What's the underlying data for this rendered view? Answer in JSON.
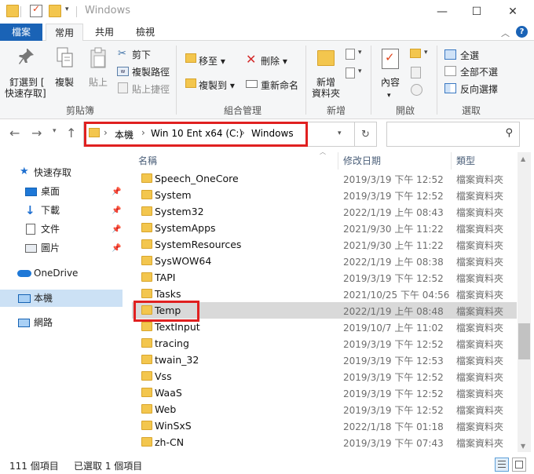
{
  "window": {
    "title": "Windows",
    "controls": {
      "minimize": "—",
      "maximize": "☐",
      "close": "✕"
    }
  },
  "ribbon_tabs": [
    {
      "label": "檔案"
    },
    {
      "label": "常用"
    },
    {
      "label": "共用"
    },
    {
      "label": "檢視"
    }
  ],
  "ribbon": {
    "clipboard": {
      "group_label": "剪貼簿",
      "pin_line1": "釘選到 [",
      "pin_line2": "快速存取]",
      "copy": "複製",
      "paste": "貼上",
      "cut": "剪下",
      "copy_path": "複製路徑",
      "paste_shortcut": "貼上捷徑"
    },
    "organize": {
      "group_label": "組合管理",
      "move_to": "移至",
      "copy_to": "複製到",
      "delete": "刪除",
      "rename": "重新命名"
    },
    "new": {
      "group_label": "新增",
      "new_folder_line1": "新增",
      "new_folder_line2": "資料夾"
    },
    "open": {
      "group_label": "開啟",
      "properties": "內容"
    },
    "select": {
      "group_label": "選取",
      "select_all": "全選",
      "select_none": "全部不選",
      "invert": "反向選擇"
    }
  },
  "address": {
    "crumbs": [
      "本機",
      "Win 10 Ent x64 (C:)",
      "Windows"
    ]
  },
  "nav": {
    "quick_access": "快速存取",
    "desktop": "桌面",
    "downloads": "下載",
    "documents": "文件",
    "pictures": "圖片",
    "onedrive": "OneDrive",
    "this_pc": "本機",
    "network": "網路"
  },
  "columns": {
    "name": "名稱",
    "date": "修改日期",
    "type": "類型"
  },
  "files": [
    {
      "name": "Speech_OneCore",
      "date": "2019/3/19 下午 12:52",
      "type": "檔案資料夾"
    },
    {
      "name": "System",
      "date": "2019/3/19 下午 12:52",
      "type": "檔案資料夾"
    },
    {
      "name": "System32",
      "date": "2022/1/19 上午 08:43",
      "type": "檔案資料夾"
    },
    {
      "name": "SystemApps",
      "date": "2021/9/30 上午 11:22",
      "type": "檔案資料夾"
    },
    {
      "name": "SystemResources",
      "date": "2021/9/30 上午 11:22",
      "type": "檔案資料夾"
    },
    {
      "name": "SysWOW64",
      "date": "2022/1/19 上午 08:38",
      "type": "檔案資料夾"
    },
    {
      "name": "TAPI",
      "date": "2019/3/19 下午 12:52",
      "type": "檔案資料夾"
    },
    {
      "name": "Tasks",
      "date": "2021/10/25 下午 04:56",
      "type": "檔案資料夾"
    },
    {
      "name": "Temp",
      "date": "2022/1/19 上午 08:48",
      "type": "檔案資料夾"
    },
    {
      "name": "TextInput",
      "date": "2019/10/7 上午 11:02",
      "type": "檔案資料夾"
    },
    {
      "name": "tracing",
      "date": "2019/3/19 下午 12:52",
      "type": "檔案資料夾"
    },
    {
      "name": "twain_32",
      "date": "2019/3/19 下午 12:53",
      "type": "檔案資料夾"
    },
    {
      "name": "Vss",
      "date": "2019/3/19 下午 12:52",
      "type": "檔案資料夾"
    },
    {
      "name": "WaaS",
      "date": "2019/3/19 下午 12:52",
      "type": "檔案資料夾"
    },
    {
      "name": "Web",
      "date": "2019/3/19 下午 12:52",
      "type": "檔案資料夾"
    },
    {
      "name": "WinSxS",
      "date": "2022/1/18 下午 01:18",
      "type": "檔案資料夾"
    },
    {
      "name": "zh-CN",
      "date": "2019/3/19 下午 07:43",
      "type": "檔案資料夾"
    }
  ],
  "selected_file": "Temp",
  "status": {
    "count": "111 個項目",
    "selected": "已選取 1 個項目"
  },
  "colors": {
    "file_tab": "#1a63b6",
    "highlight": "#e02020",
    "selected_row": "#d9d9d9",
    "folder": "#f3c64e"
  }
}
